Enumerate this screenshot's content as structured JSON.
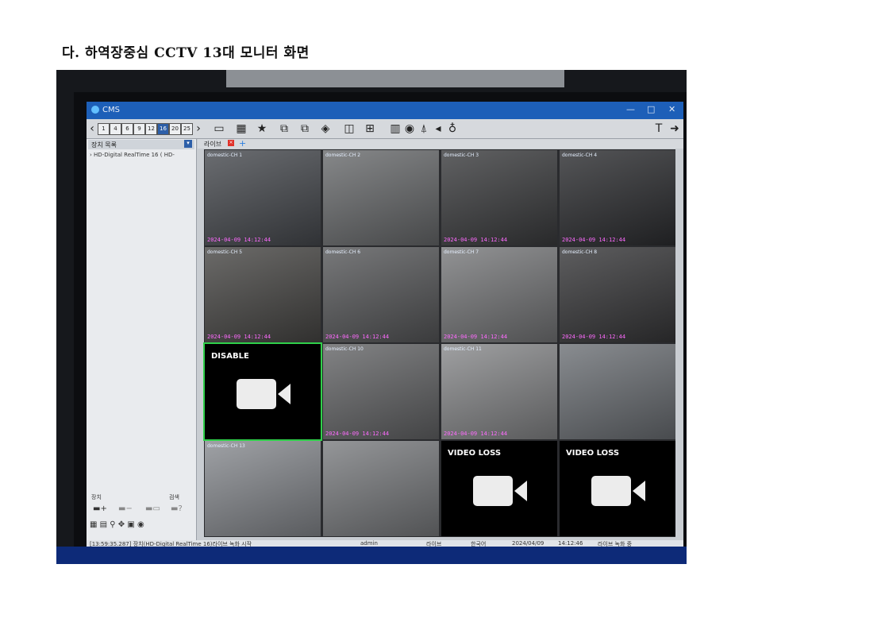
{
  "heading": "다. 하역장중심 CCTV 13대 모니터 화면",
  "cms": {
    "title": "CMS",
    "window_controls": [
      "—",
      "□",
      "✕"
    ],
    "layout_buttons": [
      "1",
      "4",
      "6",
      "9",
      "12",
      "16",
      "20",
      "25"
    ],
    "active_layout": "16",
    "sidebar": {
      "header": "장치 목록",
      "device": "HD-Digital RealTime 16 ( HD-",
      "device_label": "장치",
      "search_label": "검색"
    },
    "live_tab": "라이브",
    "cells": [
      {
        "label": "domestic-CH 1",
        "ts": "2024-04-09 14:12:44",
        "tone": "#4a4d52"
      },
      {
        "label": "domestic-CH 2",
        "ts": "",
        "tone": "#6c6e70"
      },
      {
        "label": "domestic-CH 3",
        "ts": "2024-04-09 14:12:44",
        "tone": "#3e3f41"
      },
      {
        "label": "domestic-CH 4",
        "ts": "2024-04-09 14:12:44",
        "tone": "#2f3033"
      },
      {
        "label": "domestic-CH 5",
        "ts": "2024-04-09 14:12:44",
        "tone": "#4b4a48"
      },
      {
        "label": "domestic-CH 6",
        "ts": "2024-04-09 14:12:44",
        "tone": "#5a5b5d"
      },
      {
        "label": "domestic-CH 7",
        "ts": "2024-04-09 14:12:44",
        "tone": "#7a7b7d"
      },
      {
        "label": "domestic-CH 8",
        "ts": "2024-04-09 14:12:44",
        "tone": "#3a3a3c"
      },
      {
        "label": "",
        "ts": "",
        "msg": "DISABLE",
        "tone": "#000000",
        "selected": true
      },
      {
        "label": "domestic-CH 10",
        "ts": "2024-04-09 14:12:44",
        "tone": "#67686a"
      },
      {
        "label": "domestic-CH 11",
        "ts": "2024-04-09 14:12:44",
        "tone": "#8a8b8d"
      },
      {
        "label": "",
        "ts": "",
        "tone": "#6f7378"
      },
      {
        "label": "domestic-CH 13",
        "ts": "",
        "tone": "#8a8d92"
      },
      {
        "label": "",
        "ts": "",
        "tone": "#7d7f82"
      },
      {
        "label": "",
        "ts": "",
        "msg": "VIDEO LOSS",
        "tone": "#000000"
      },
      {
        "label": "",
        "ts": "",
        "msg": "VIDEO LOSS",
        "tone": "#000000"
      }
    ],
    "status": {
      "log": "[13:59:35.287] 장치(HD-Digital RealTime 16)라이브 녹화 시작",
      "user": "admin",
      "mode": "라이브",
      "language": "한국어",
      "date": "2024/04/09",
      "time": "14:12:46",
      "recording": "라이브 녹화 중"
    }
  }
}
